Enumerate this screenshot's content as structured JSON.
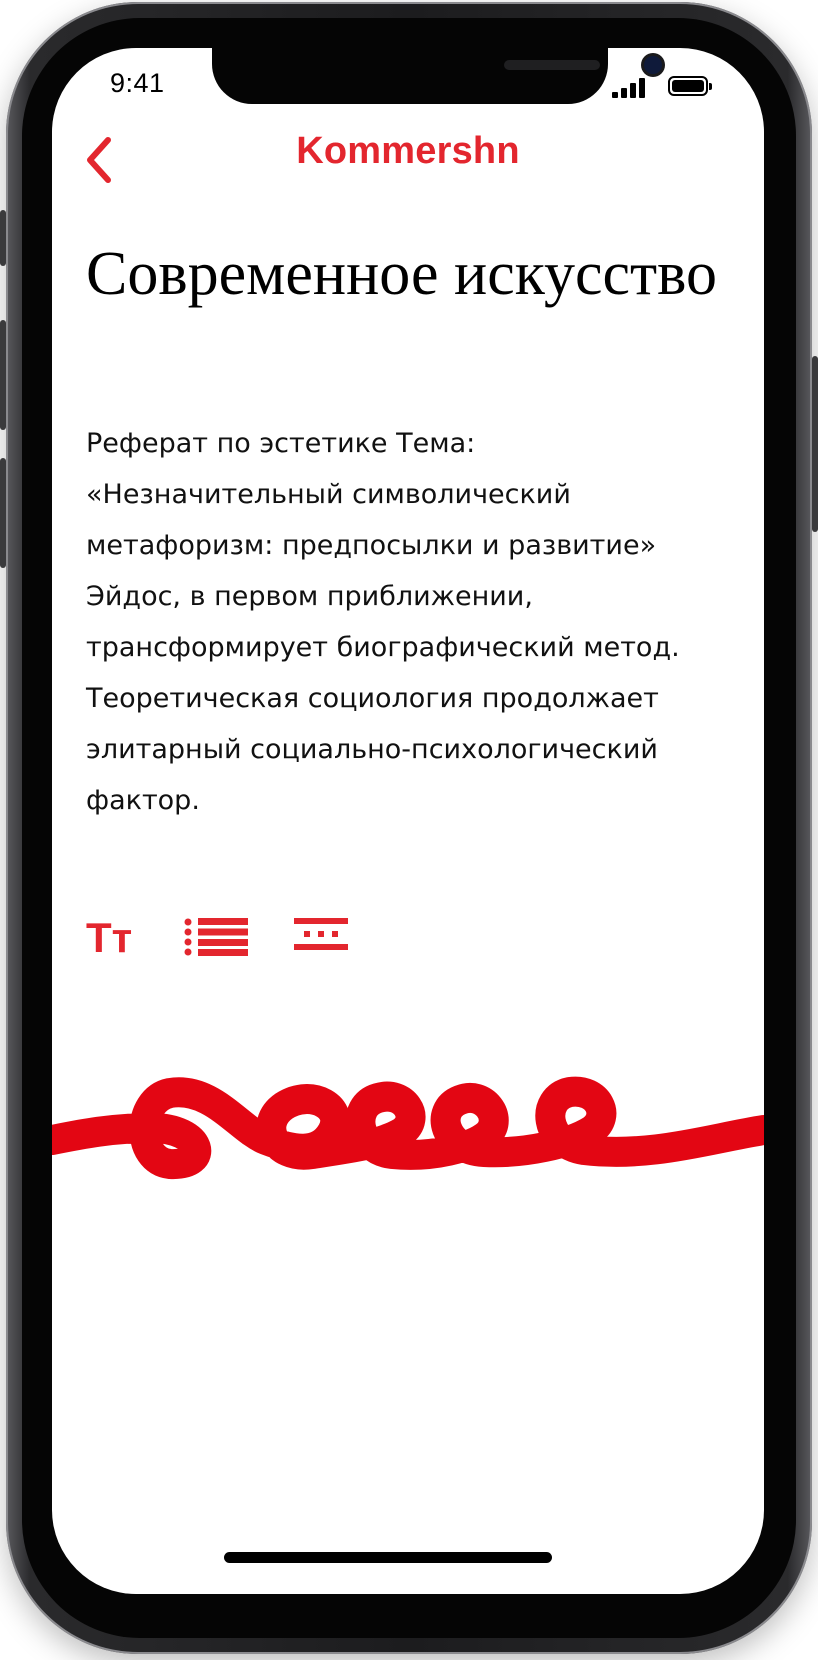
{
  "status_bar": {
    "time": "9:41"
  },
  "header": {
    "brand": "Kommershn"
  },
  "article": {
    "title": "Современное искусство",
    "body": "Реферат по эстетике Тема: «Незначительный символический метафоризм: предпосылки и развитие» Эйдос, в первом приближении, трансформирует биографический метод. Теоретическая социология продолжает элитарный социально-психологический фактор."
  },
  "toolbar": {
    "text_size_label": "Тт"
  },
  "colors": {
    "accent": "#e3262e",
    "squiggle": "#e30613",
    "text": "#111111"
  },
  "icons": [
    "back-chevron-icon",
    "list-icon",
    "spacing-icon"
  ]
}
